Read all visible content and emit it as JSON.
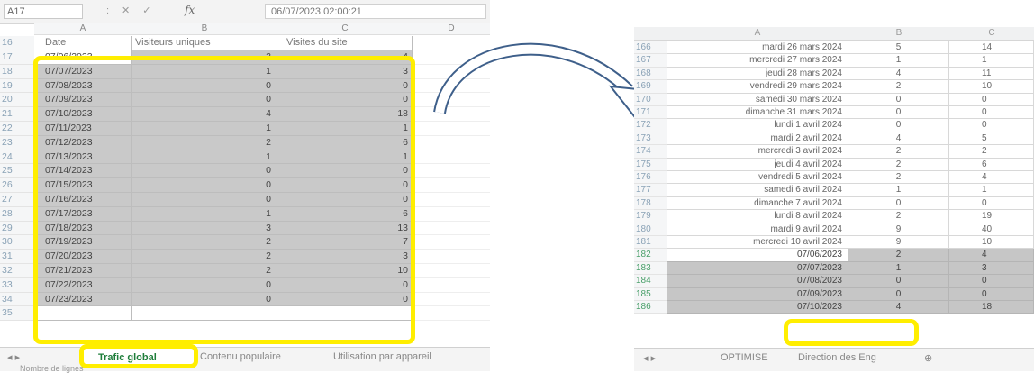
{
  "left": {
    "name_box": "A17",
    "formula_value": "06/07/2023 02:00:21",
    "columns": [
      "A",
      "B",
      "C",
      "D"
    ],
    "header_row": {
      "num": "16",
      "a": "Date",
      "b": "Visiteurs uniques",
      "c": "Visites du site"
    },
    "rows": [
      {
        "num": "17",
        "date": "07/06/2023",
        "b": "2",
        "c": "4"
      },
      {
        "num": "18",
        "date": "07/07/2023",
        "b": "1",
        "c": "3"
      },
      {
        "num": "19",
        "date": "07/08/2023",
        "b": "0",
        "c": "0"
      },
      {
        "num": "20",
        "date": "07/09/2023",
        "b": "0",
        "c": "0"
      },
      {
        "num": "21",
        "date": "07/10/2023",
        "b": "4",
        "c": "18"
      },
      {
        "num": "22",
        "date": "07/11/2023",
        "b": "1",
        "c": "1"
      },
      {
        "num": "23",
        "date": "07/12/2023",
        "b": "2",
        "c": "6"
      },
      {
        "num": "24",
        "date": "07/13/2023",
        "b": "1",
        "c": "1"
      },
      {
        "num": "25",
        "date": "07/14/2023",
        "b": "0",
        "c": "0"
      },
      {
        "num": "26",
        "date": "07/15/2023",
        "b": "0",
        "c": "0"
      },
      {
        "num": "27",
        "date": "07/16/2023",
        "b": "0",
        "c": "0"
      },
      {
        "num": "28",
        "date": "07/17/2023",
        "b": "1",
        "c": "6"
      },
      {
        "num": "29",
        "date": "07/18/2023",
        "b": "3",
        "c": "13"
      },
      {
        "num": "30",
        "date": "07/19/2023",
        "b": "2",
        "c": "7"
      },
      {
        "num": "31",
        "date": "07/20/2023",
        "b": "2",
        "c": "3"
      },
      {
        "num": "32",
        "date": "07/21/2023",
        "b": "2",
        "c": "10"
      },
      {
        "num": "33",
        "date": "07/22/2023",
        "b": "0",
        "c": "0"
      },
      {
        "num": "34",
        "date": "07/23/2023",
        "b": "0",
        "c": "0"
      },
      {
        "num": "35",
        "date": "",
        "b": "",
        "c": ""
      }
    ],
    "tabs": {
      "t1": "Trafic global",
      "t2": "Contenu populaire",
      "t3": "Utilisation par appareil"
    },
    "status": "Nombre de lignes"
  },
  "right": {
    "columns": [
      "A",
      "B",
      "C"
    ],
    "rows": [
      {
        "num": "166",
        "a": "mardi 26 mars 2024",
        "b": "5",
        "c": "14"
      },
      {
        "num": "167",
        "a": "mercredi 27 mars 2024",
        "b": "1",
        "c": "1"
      },
      {
        "num": "168",
        "a": "jeudi 28 mars 2024",
        "b": "4",
        "c": "11"
      },
      {
        "num": "169",
        "a": "vendredi 29 mars 2024",
        "b": "2",
        "c": "10"
      },
      {
        "num": "170",
        "a": "samedi 30 mars 2024",
        "b": "0",
        "c": "0"
      },
      {
        "num": "171",
        "a": "dimanche 31 mars 2024",
        "b": "0",
        "c": "0"
      },
      {
        "num": "172",
        "a": "lundi 1 avril 2024",
        "b": "0",
        "c": "0"
      },
      {
        "num": "173",
        "a": "mardi 2 avril 2024",
        "b": "4",
        "c": "5"
      },
      {
        "num": "174",
        "a": "mercredi 3 avril 2024",
        "b": "2",
        "c": "2"
      },
      {
        "num": "175",
        "a": "jeudi 4 avril 2024",
        "b": "2",
        "c": "6"
      },
      {
        "num": "176",
        "a": "vendredi 5 avril 2024",
        "b": "2",
        "c": "4"
      },
      {
        "num": "177",
        "a": "samedi 6 avril 2024",
        "b": "1",
        "c": "1"
      },
      {
        "num": "178",
        "a": "dimanche 7 avril 2024",
        "b": "0",
        "c": "0"
      },
      {
        "num": "179",
        "a": "lundi 8 avril 2024",
        "b": "2",
        "c": "19"
      },
      {
        "num": "180",
        "a": "mardi 9 avril 2024",
        "b": "9",
        "c": "40"
      },
      {
        "num": "181",
        "a": "mercredi 10 avril 2024",
        "b": "9",
        "c": "10"
      },
      {
        "num": "182",
        "a": "07/06/2023",
        "b": "2",
        "c": "4"
      },
      {
        "num": "183",
        "a": "07/07/2023",
        "b": "1",
        "c": "3"
      },
      {
        "num": "184",
        "a": "07/08/2023",
        "b": "0",
        "c": "0"
      },
      {
        "num": "185",
        "a": "07/09/2023",
        "b": "0",
        "c": "0"
      },
      {
        "num": "186",
        "a": "07/10/2023",
        "b": "4",
        "c": "18"
      }
    ],
    "tabs": {
      "t1": "OPTIMISE",
      "t2": "Direction des Eng"
    }
  },
  "colors": {
    "highlight": "#ffee00",
    "selection": "#c9c9c9",
    "active_tab": "#1e7d3a"
  }
}
